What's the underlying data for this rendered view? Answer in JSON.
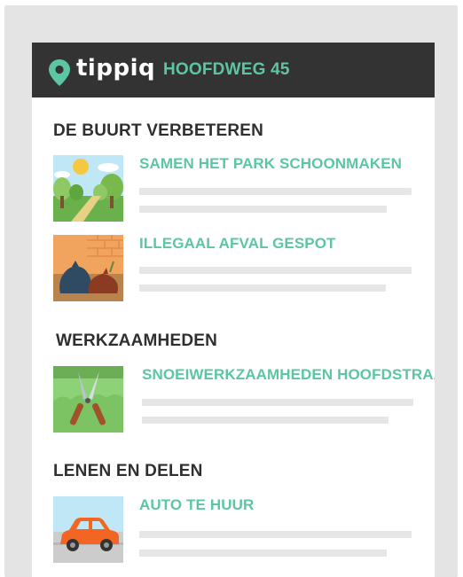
{
  "header": {
    "brand": "tippiq",
    "address": "HOOFDWEG 45",
    "pin_icon": "map-pin-icon",
    "colors": {
      "header_bg": "#333333",
      "accent": "#5cc6a4"
    }
  },
  "sections": [
    {
      "title": "DE BUURT VERBETEREN",
      "items": [
        {
          "title": "SAMEN HET PARK SCHOONMAKEN",
          "icon": "park-icon"
        },
        {
          "title": "ILLEGAAL AFVAL GESPOT",
          "icon": "trash-bags-icon"
        }
      ]
    },
    {
      "title": "WERKZAAMHEDEN",
      "items": [
        {
          "title": "SNOEIWERKZAAMHEDEN HOOFDSTRAAT",
          "icon": "hedge-shears-icon"
        }
      ]
    },
    {
      "title": "LENEN EN DELEN",
      "items": [
        {
          "title": "AUTO TE HUUR",
          "icon": "car-icon"
        }
      ]
    }
  ]
}
